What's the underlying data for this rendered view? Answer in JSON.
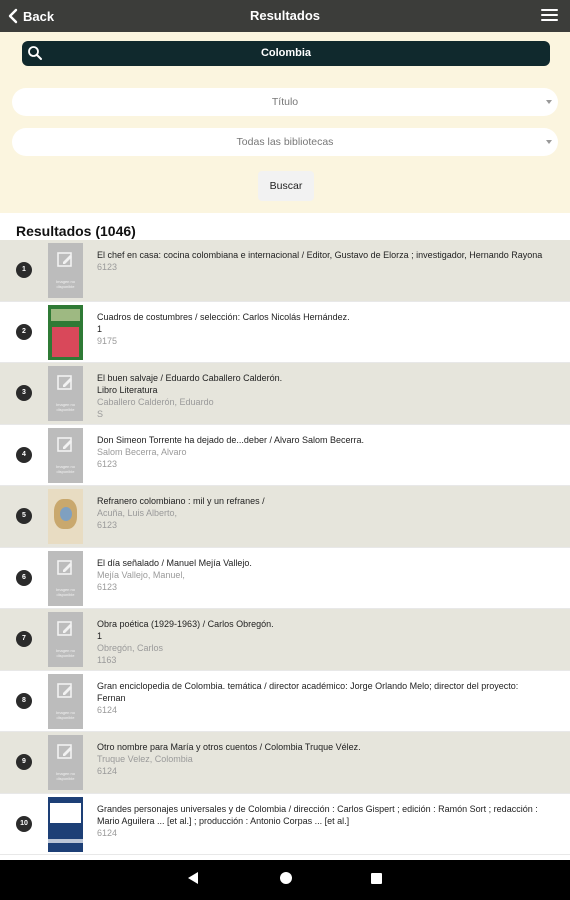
{
  "header": {
    "back_label": "Back",
    "title": "Resultados"
  },
  "search": {
    "query": "Colombia",
    "field_select": "Título",
    "library_select": "Todas las bibliotecas",
    "button_label": "Buscar"
  },
  "results": {
    "heading": "Resultados (1046)",
    "placeholder_text": "Imagen no disponible",
    "items": [
      {
        "num": "1",
        "title": "El chef en casa: cocina colombiana e internacional / Editor, Gustavo de Elorza ; investigador, Hernando Rayona",
        "line2": "",
        "line3": "",
        "line4": "6123"
      },
      {
        "num": "2",
        "title": "Cuadros de costumbres / selección: Carlos Nicolás Hernández.",
        "line2": "1",
        "line3": "",
        "line4": "9175"
      },
      {
        "num": "3",
        "title": "El buen salvaje / Eduardo Caballero Calderón.",
        "line2": "Libro Literatura",
        "line3": "Caballero Calderón, Eduardo",
        "line4": "S"
      },
      {
        "num": "4",
        "title": "Don Simeon Torrente ha dejado de...deber / Alvaro Salom Becerra.",
        "line2": "",
        "line3": "Salom Becerra, Alvaro",
        "line4": "6123"
      },
      {
        "num": "5",
        "title": "Refranero colombiano : mil y un refranes /",
        "line2": "",
        "line3": "Acuña, Luis Alberto,",
        "line4": "6123"
      },
      {
        "num": "6",
        "title": "El día señalado / Manuel Mejía Vallejo.",
        "line2": "",
        "line3": "Mejía Vallejo, Manuel,",
        "line4": "6123"
      },
      {
        "num": "7",
        "title": "Obra poética (1929-1963) / Carlos Obregón.",
        "line2": "1",
        "line3": "Obregón, Carlos",
        "line4": "1163"
      },
      {
        "num": "8",
        "title": "Gran enciclopedia de Colombia. temática / director académico: Jorge Orlando Melo; director del proyecto: Fernan",
        "line2": "",
        "line3": "",
        "line4": "6124"
      },
      {
        "num": "9",
        "title": "Otro nombre para María y otros cuentos / Colombia Truque Vélez.",
        "line2": "",
        "line3": "Truque Velez, Colombia",
        "line4": "6124"
      },
      {
        "num": "10",
        "title": "Grandes personajes universales y de Colombia / dirección : Carlos Gispert ; edición : Ramón Sort ; redacción : Mario Aguilera ... [et al.] ; producción : Antonio Corpas ... [et al.]",
        "line2": "",
        "line3": "",
        "line4": "6124"
      }
    ]
  },
  "icons": {
    "back": "chevron-left-icon",
    "menu": "hamburger-menu-icon",
    "search": "magnifier-icon",
    "placeholder": "edit-image-icon"
  },
  "colors": {
    "topbar": "#3c3d3a",
    "search_panel": "#fbf5df",
    "search_bar": "#10292d",
    "row_shade": "#e6e5dc",
    "secondary_text": "#9a9a9a"
  }
}
